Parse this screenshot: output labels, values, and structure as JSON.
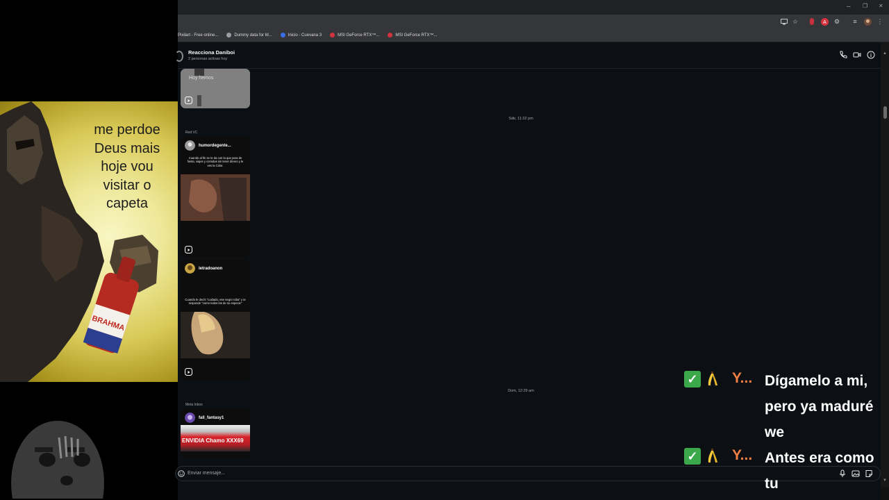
{
  "overlay": {
    "meme_lines": [
      "me perdoe",
      "Deus mais",
      "hoje vou",
      "visitar o",
      "capeta"
    ],
    "bottle_label": "BRAHMA"
  },
  "window_controls": {
    "minimize": "–",
    "restore": "❐",
    "close": "✕"
  },
  "bookmarks": [
    {
      "label": "Pixilart - Free online...",
      "icon_color": "#e9c04b"
    },
    {
      "label": "Dummy data for M...",
      "icon_color": "#9aa0a6"
    },
    {
      "label": "Inicio - Cuevana 3",
      "icon_color": "#3a6ee8"
    },
    {
      "label": "MSI GeForce RTX™...",
      "icon_color": "#d3323f"
    },
    {
      "label": "MSI GeForce RTX™...",
      "icon_color": "#d3323f"
    }
  ],
  "chat": {
    "title": "Reacciona Daniboi",
    "subtitle": "2 personas activas hoy",
    "top_card_text": "Hoy hemos",
    "label_red_vc": "Red VC",
    "timestamp_sat": "Sáb, 11:32 pm",
    "timestamp_sun": "Dom, 12:29 am",
    "card1": {
      "username": "humordegente...",
      "caption": "Cuando al fin se te da con la que para de fiesta, viajes y comidas sin tener dinero y le ves la Cúlor."
    },
    "card2": {
      "username": "letradoanon",
      "caption": "Cuando le decís \"cuidado, ese negro roba\" y te responde \"como todos los de su especie\""
    },
    "label_meta_inbox": "Meta Inbox",
    "card3": {
      "username": "fall_fantasy1",
      "banner_text": "ENVIDIA Chamo XXX69"
    },
    "composer_placeholder": "Enviar mensaje..."
  },
  "stream_messages": [
    {
      "user": "Y...",
      "text_lines": [
        "Dígamelo a mi,",
        "pero ya maduré",
        "we"
      ]
    },
    {
      "user": "Y...",
      "text_lines": [
        "Antes era como",
        "tu"
      ]
    }
  ],
  "colors": {
    "chat_bg": "#0c1014",
    "username_orange": "#f07e44",
    "badge_green": "#3ba94a",
    "browser_toolbar": "#35363a"
  }
}
